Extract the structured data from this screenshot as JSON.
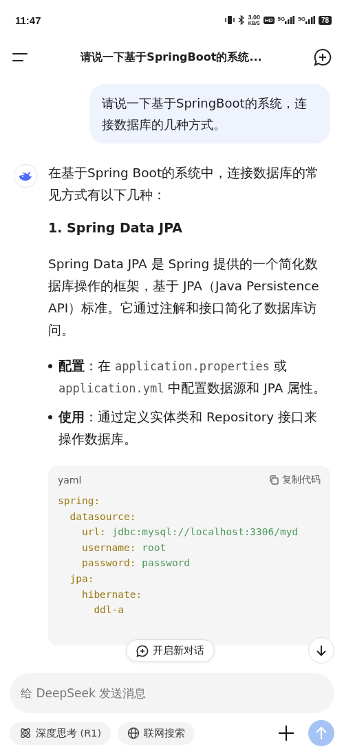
{
  "status_bar": {
    "time": "11:47",
    "speed": "3.00",
    "speed_unit": "KB/S",
    "hd": "HD",
    "network_1": "5G",
    "network_2": "5G",
    "battery": "78"
  },
  "header": {
    "title": "请说一下基于SpringBoot的系统..."
  },
  "messages": [
    {
      "kind": "user",
      "text": "请说一下基于SpringBoot的系统，连接数据库的几种方式。"
    },
    {
      "kind": "assistant",
      "blocks": [
        {
          "kind": "paragraph",
          "text": "在基于Spring Boot的系统中，连接数据库的常见方式有以下几种："
        },
        {
          "kind": "heading",
          "text": "1. Spring Data JPA"
        },
        {
          "kind": "paragraph",
          "text": "Spring Data JPA 是 Spring 提供的一个简化数据库操作的框架，基于 JPA（Java Persistence API）标准。它通过注解和接口简化了数据库访问。"
        },
        {
          "kind": "bullets",
          "items": [
            {
              "parts": [
                {
                  "kind": "bold",
                  "text": "配置"
                },
                {
                  "kind": "plain",
                  "text": "：在 "
                },
                {
                  "kind": "code",
                  "text": "application.properties"
                },
                {
                  "kind": "plain",
                  "text": " 或 "
                },
                {
                  "kind": "code",
                  "text": "application.yml"
                },
                {
                  "kind": "plain",
                  "text": " 中配置数据源和 JPA 属性。"
                }
              ]
            },
            {
              "parts": [
                {
                  "kind": "bold",
                  "text": "使用"
                },
                {
                  "kind": "plain",
                  "text": "：通过定义实体类和 Repository 接口来操作数据库。"
                }
              ]
            }
          ]
        },
        {
          "kind": "code",
          "language": "yaml",
          "copy_label": "复制代码",
          "lines": [
            {
              "key": "spring:"
            },
            {
              "key": "  datasource:"
            },
            {
              "key": "    url:",
              "value": " jdbc:mysql://localhost:3306/myd"
            },
            {
              "key": "    username:",
              "value": " root"
            },
            {
              "key": "    password:",
              "value": " password"
            },
            {
              "key": "  jpa:"
            },
            {
              "key": "    hibernate:"
            },
            {
              "key": "      ddl-a"
            }
          ]
        }
      ]
    }
  ],
  "new_chat_button": "开启新对话",
  "composer": {
    "placeholder": "给 DeepSeek 发送消息",
    "chips": [
      {
        "label": "深度思考 (R1)",
        "kind": "think",
        "selected": false
      },
      {
        "label": "联网搜索",
        "kind": "web",
        "selected": false
      }
    ],
    "send_enabled": false
  }
}
